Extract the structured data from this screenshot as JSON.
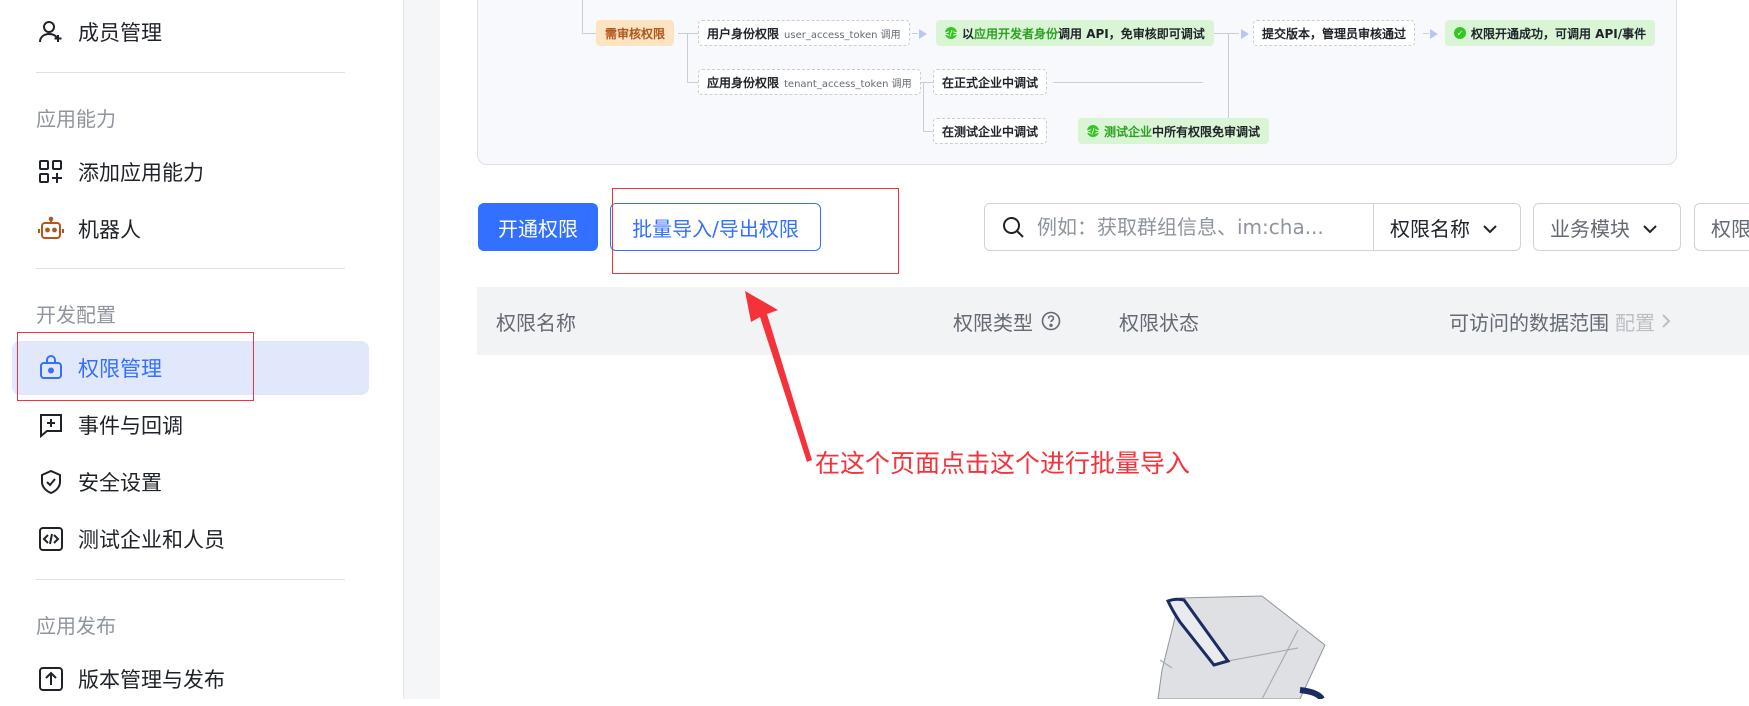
{
  "sidebar": {
    "items_top": [
      {
        "label": "成员管理",
        "icon": "member-add-icon"
      }
    ],
    "groups": [
      {
        "title": "应用能力",
        "items": [
          {
            "label": "添加应用能力",
            "icon": "app-grid-add-icon"
          },
          {
            "label": "机器人",
            "icon": "robot-icon"
          }
        ]
      },
      {
        "title": "开发配置",
        "items": [
          {
            "label": "权限管理",
            "icon": "lock-bag-icon",
            "active": true
          },
          {
            "label": "事件与回调",
            "icon": "event-callback-icon"
          },
          {
            "label": "安全设置",
            "icon": "shield-check-icon"
          },
          {
            "label": "测试企业和人员",
            "icon": "code-box-icon"
          }
        ]
      },
      {
        "title": "应用发布",
        "items": [
          {
            "label": "版本管理与发布",
            "icon": "upload-box-icon"
          }
        ]
      }
    ]
  },
  "flow": {
    "need_review": "需审核权限",
    "user_perm": "用户身份权限",
    "user_token": "user_access_token 调用",
    "green1_prefix": "以",
    "green1_hl": "应用开发者身份",
    "green1_suffix": "调用 API，免审核即可调试",
    "submit": "提交版本，管理员审核通过",
    "success": "权限开通成功，可调用 API/事件",
    "app_perm": "应用身份权限",
    "app_token": "tenant_access_token 调用",
    "formal_debug": "在正式企业中调试",
    "test_debug": "在测试企业中调试",
    "green2_hl": "测试企业",
    "green2_suffix": "中所有权限免审调试"
  },
  "toolbar": {
    "enable_label": "开通权限",
    "batch_label": "批量导入/导出权限",
    "search_placeholder": "例如：获取群组信息、im:cha...",
    "filter_name": "权限名称",
    "filter_module": "业务模块",
    "filter_third": "权限"
  },
  "table": {
    "columns": [
      "权限名称",
      "权限类型",
      "权限状态",
      "可访问的数据范围"
    ],
    "config_label": "配置"
  },
  "annotation": {
    "text": "在这个页面点击这个进行批量导入",
    "color": "#f5313a"
  },
  "colors": {
    "primary": "#3370ff",
    "active_bg": "#e1e8fc"
  }
}
